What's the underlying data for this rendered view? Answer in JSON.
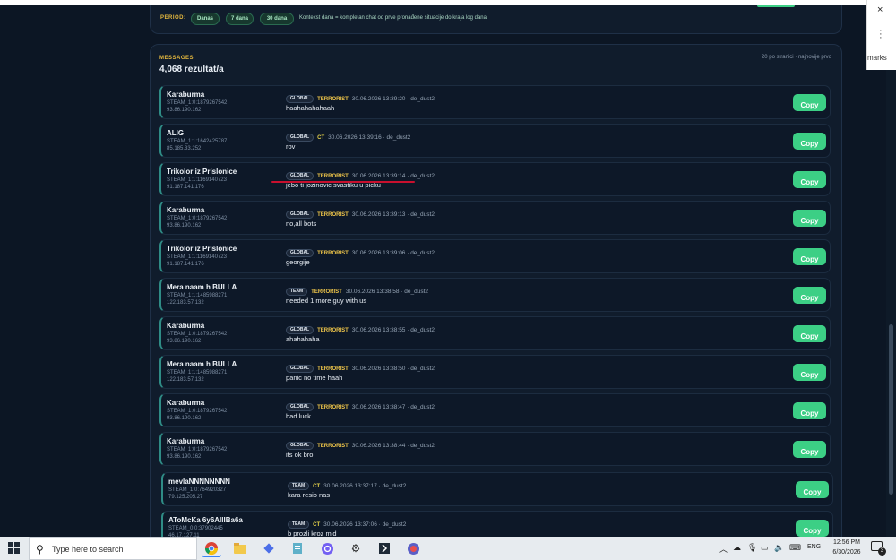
{
  "period": {
    "label": "PERIOD:",
    "options": [
      "Danas",
      "7 dana",
      "30 dana"
    ],
    "note": "Kontekst dana = kompletan chat od prve pronađene situacije do kraja log dana"
  },
  "messages": {
    "heading": "MESSAGES",
    "count": "4,068 rezultat/a",
    "per_page": "20 po stranici · najnovije prvo",
    "copy_label": "Copy",
    "rows": [
      {
        "name": "Karaburma",
        "steam": "STEAM_1:0:1879267542",
        "ip": "93.86.190.162",
        "scope": "GLOBAL",
        "team": "TERRORIST",
        "time": "30.06.2026 13:39:20 · de_dust2",
        "text": "haahahahahaah"
      },
      {
        "name": "ALIG",
        "steam": "STEAM_1:1:1642425787",
        "ip": "85.185.33.252",
        "scope": "GLOBAL",
        "team": "CT",
        "time": "30.06.2026 13:39:16 · de_dust2",
        "text": "rov"
      },
      {
        "name": "Trikolor iz Prislonice",
        "steam": "STEAM_1:1:1169140723",
        "ip": "91.187.141.176",
        "scope": "GLOBAL",
        "team": "TERRORIST",
        "time": "30.06.2026 13:39:14 · de_dust2",
        "text": "jebo ti jozinovic svastiku u picku"
      },
      {
        "name": "Karaburma",
        "steam": "STEAM_1:0:1879267542",
        "ip": "93.86.190.162",
        "scope": "GLOBAL",
        "team": "TERRORIST",
        "time": "30.06.2026 13:39:13 · de_dust2",
        "text": "no,all bots"
      },
      {
        "name": "Trikolor iz Prislonice",
        "steam": "STEAM_1:1:1169140723",
        "ip": "91.187.141.176",
        "scope": "GLOBAL",
        "team": "TERRORIST",
        "time": "30.06.2026 13:39:06 · de_dust2",
        "text": "georgije"
      },
      {
        "name": "Mera naam h BULLA",
        "steam": "STEAM_1:1:1485988271",
        "ip": "122.183.57.132",
        "scope": "TEAM",
        "team": "TERRORIST",
        "time": "30.06.2026 13:38:58 · de_dust2",
        "text": "needed 1 more guy with us"
      },
      {
        "name": "Karaburma",
        "steam": "STEAM_1:0:1879267542",
        "ip": "93.86.190.162",
        "scope": "GLOBAL",
        "team": "TERRORIST",
        "time": "30.06.2026 13:38:55 · de_dust2",
        "text": "ahahahaha"
      },
      {
        "name": "Mera naam h BULLA",
        "steam": "STEAM_1:1:1485988271",
        "ip": "122.183.57.132",
        "scope": "GLOBAL",
        "team": "TERRORIST",
        "time": "30.06.2026 13:38:50 · de_dust2",
        "text": "panic no time haah"
      },
      {
        "name": "Karaburma",
        "steam": "STEAM_1:0:1879267542",
        "ip": "93.86.190.162",
        "scope": "GLOBAL",
        "team": "TERRORIST",
        "time": "30.06.2026 13:38:47 · de_dust2",
        "text": "bad luck"
      },
      {
        "name": "Karaburma",
        "steam": "STEAM_1:0:1879267542",
        "ip": "93.86.190.162",
        "scope": "GLOBAL",
        "team": "TERRORIST",
        "time": "30.06.2026 13:38:44 · de_dust2",
        "text": "its ok bro"
      },
      {
        "name": "mevlaNNNNNNNN",
        "steam": "STEAM_1:0:764920327",
        "ip": "79.125.205.27",
        "scope": "TEAM",
        "team": "CT",
        "time": "30.06.2026 13:37:17 · de_dust2",
        "text": "kara resio nas"
      },
      {
        "name": "AToMcKa 6y6AllIBa6a",
        "steam": "STEAM_0:0:37902445",
        "ip": "46.17.127.11",
        "scope": "TEAM",
        "team": "CT",
        "time": "30.06.2026 13:37:06 · de_dust2",
        "text": "b prozli kroz mid"
      }
    ]
  },
  "side_popup": {
    "close": "×",
    "text": "marks"
  },
  "taskbar": {
    "search_placeholder": "Type here to search",
    "apps": [
      "chrome-icon",
      "file-explorer-icon",
      "kodi-icon",
      "notepad-icon",
      "viber-icon",
      "settings-icon",
      "steam-icon",
      "media-icon"
    ],
    "language": "ENG",
    "time": "12:56 PM",
    "date": "6/30/2026",
    "notification_count": "3"
  },
  "colors": {
    "background": "#0c1624",
    "panel": "#101c2c",
    "accent_yellow": "#e5b83e",
    "copy_button": "#3ccf85",
    "row_border": "#2f8c86"
  }
}
